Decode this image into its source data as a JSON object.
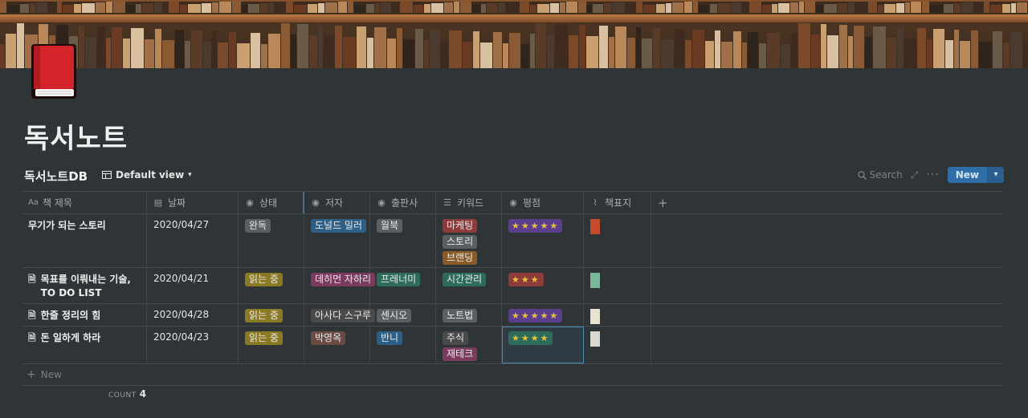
{
  "page": {
    "title": "독서노트"
  },
  "database": {
    "name": "독서노트DB",
    "view_label": "Default view",
    "search_label": "Search",
    "new_label": "New",
    "new_row_label": "New",
    "count_label": "COUNT",
    "count_value": "4"
  },
  "columns": [
    {
      "label": "책 제목",
      "icon": "Aa"
    },
    {
      "label": "날짜",
      "icon": "calendar-icon"
    },
    {
      "label": "상태",
      "icon": "select-icon"
    },
    {
      "label": "저자",
      "icon": "select-icon"
    },
    {
      "label": "출판사",
      "icon": "select-icon"
    },
    {
      "label": "키워드",
      "icon": "list-icon"
    },
    {
      "label": "평점",
      "icon": "select-icon"
    },
    {
      "label": "책표지",
      "icon": "paperclip-icon"
    }
  ],
  "rows": [
    {
      "title": "무기가 되는 스토리",
      "has_doc_icon": false,
      "date": "2020/04/27",
      "status": "완독",
      "status_color": "#5a5f63",
      "author": "도널드 밀러",
      "author_color": "#2e5f87",
      "publisher": "월북",
      "publisher_color": "#5a5f63",
      "keywords": [
        {
          "label": "마케팅",
          "color": "#8e3b3b"
        },
        {
          "label": "스토리",
          "color": "#5a5f63"
        },
        {
          "label": "브랜딩",
          "color": "#8a5b28"
        }
      ],
      "rating": "★★★★★",
      "rating_color": "#5b3f8c",
      "cover_color": "#c44a2a"
    },
    {
      "title": "목표를 이뤄내는 기술, TO DO LIST",
      "has_doc_icon": true,
      "date": "2020/04/21",
      "status": "읽는 중",
      "status_color": "#8a7a25",
      "author": "데히먼 자하리",
      "author_color": "#7a3b5e",
      "publisher": "프레너미",
      "publisher_color": "#2f6b5a",
      "keywords": [
        {
          "label": "시간관리",
          "color": "#2f6b5a"
        }
      ],
      "rating": "★★★",
      "rating_color": "#8e3b3b",
      "cover_color": "#7ab89a"
    },
    {
      "title": "한줄 정리의 힘",
      "has_doc_icon": true,
      "date": "2020/04/28",
      "status": "읽는 중",
      "status_color": "#8a7a25",
      "author": "아사다 스구루",
      "author_color": "#4a4a4a",
      "publisher": "센시오",
      "publisher_color": "#5a5f63",
      "keywords": [
        {
          "label": "노트법",
          "color": "#5a5f63"
        }
      ],
      "rating": "★★★★★",
      "rating_color": "#5b3f8c",
      "cover_color": "#e8e2d2"
    },
    {
      "title": "돈 일하게 하라",
      "has_doc_icon": true,
      "date": "2020/04/23",
      "status": "읽는 중",
      "status_color": "#8a7a25",
      "author": "박영옥",
      "author_color": "#6b4a44",
      "publisher": "반니",
      "publisher_color": "#2e5f87",
      "keywords": [
        {
          "label": "주식",
          "color": "#4a4a4a"
        },
        {
          "label": "재테크",
          "color": "#7a3b5e"
        }
      ],
      "rating": "★★★★",
      "rating_color": "#2f6b5a",
      "cover_color": "#d8d8d0"
    }
  ]
}
